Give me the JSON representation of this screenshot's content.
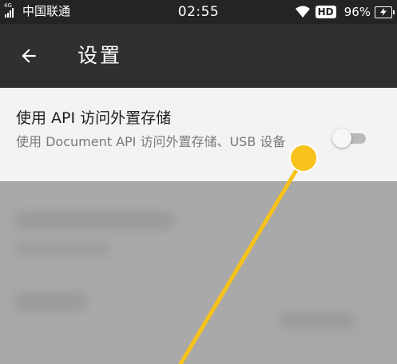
{
  "status_bar": {
    "network_tag": "4G",
    "carrier": "中国联通",
    "time": "02:55",
    "hd_badge": "HD",
    "battery_percent": "96%",
    "battery_level": 0.96
  },
  "app_bar": {
    "title": "设置",
    "back_icon": "arrow-left-icon"
  },
  "settings": {
    "items": [
      {
        "title": "使用 API 访问外置存储",
        "summary": "使用 Document API 访问外置存储、USB 设备",
        "toggle_on": false
      }
    ]
  },
  "colors": {
    "status_bar_bg": "#242424",
    "app_bar_bg": "#303030",
    "row_bg": "#f3f3f3",
    "touch_indicator": "#f7c21a",
    "dimmed_content": "#a9a9a9"
  }
}
